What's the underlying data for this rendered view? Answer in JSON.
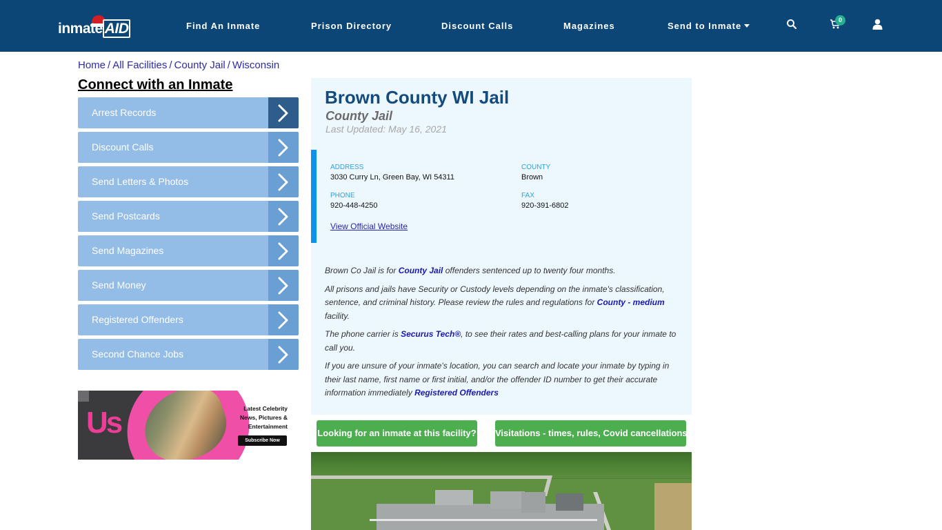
{
  "header": {
    "logo_text_prefix": "inmate",
    "logo_text_suffix": "AID",
    "nav": [
      {
        "label": "Find An Inmate"
      },
      {
        "label": "Prison Directory"
      },
      {
        "label": "Discount Calls"
      },
      {
        "label": "Magazines"
      },
      {
        "label": "Send to Inmate",
        "has_dropdown": true
      }
    ],
    "icons": {
      "search": "search-icon",
      "cart": "cart-icon",
      "user": "user-icon"
    },
    "cart_count": "0"
  },
  "breadcrumb": [
    {
      "label": "Home"
    },
    {
      "label": "All Facilities"
    },
    {
      "label": "County Jail"
    },
    {
      "label": "Wisconsin"
    }
  ],
  "breadcrumb_separator": "/",
  "sidebar": {
    "title": "Connect with an Inmate",
    "items": [
      {
        "label": "Arrest Records",
        "active": true
      },
      {
        "label": "Discount Calls"
      },
      {
        "label": "Send Letters & Photos"
      },
      {
        "label": "Send Postcards"
      },
      {
        "label": "Send Magazines"
      },
      {
        "label": "Send Money"
      },
      {
        "label": "Registered Offenders"
      },
      {
        "label": "Second Chance Jobs"
      }
    ],
    "ad": {
      "brand": "Us",
      "tagline_lines": [
        "Latest Celebrity",
        "News, Pictures &",
        "Entertainment"
      ],
      "cta": "Subscribe Now"
    }
  },
  "facility": {
    "name": "Brown County WI Jail",
    "type": "County Jail",
    "last_updated": "Last Updated: May 16, 2021",
    "address_label": "ADDRESS",
    "address": "3030 Curry Ln, Green Bay, WI 54311",
    "county_label": "COUNTY",
    "county": "Brown",
    "phone_label": "PHONE",
    "phone": "920-448-4250",
    "fax_label": "FAX",
    "fax": "920-391-6802",
    "website_link": "View Official Website"
  },
  "description": {
    "p1_before": "Brown Co Jail is for ",
    "p1_link": "County Jail",
    "p1_after": " offenders sentenced up to twenty four months.",
    "p2_before": "All prisons and jails have Security or Custody levels depending on the inmate's classification, sentence, and criminal history. Please review the rules and regulations for ",
    "p2_link": "County - medium",
    "p2_after": " facility.",
    "p3_before": "The phone carrier is ",
    "p3_link": "Securus Tech®",
    "p3_after": ", to see their rates and best-calling plans for your inmate to call you.",
    "p4_before": "If you are unsure of your inmate's location, you can search and locate your inmate by typing in their last name, first name or first initial, and/or the offender ID number to get their accurate information immediately ",
    "p4_link": "Registered Offenders"
  },
  "buttons": {
    "find_inmate": "Looking for an inmate at this facility?",
    "visitations": "Visitations - times, rules, Covid cancellations"
  },
  "colors": {
    "navbar": "#0b4677",
    "sidebar_item": "#93bde6",
    "sidebar_arrow": "#6a9fd4",
    "sidebar_arrow_active": "#2f5d8b",
    "panel_bg": "#edf7fe",
    "accent_border": "#0f92ee",
    "green_button": "#4cae4f",
    "title": "#144a7c"
  }
}
